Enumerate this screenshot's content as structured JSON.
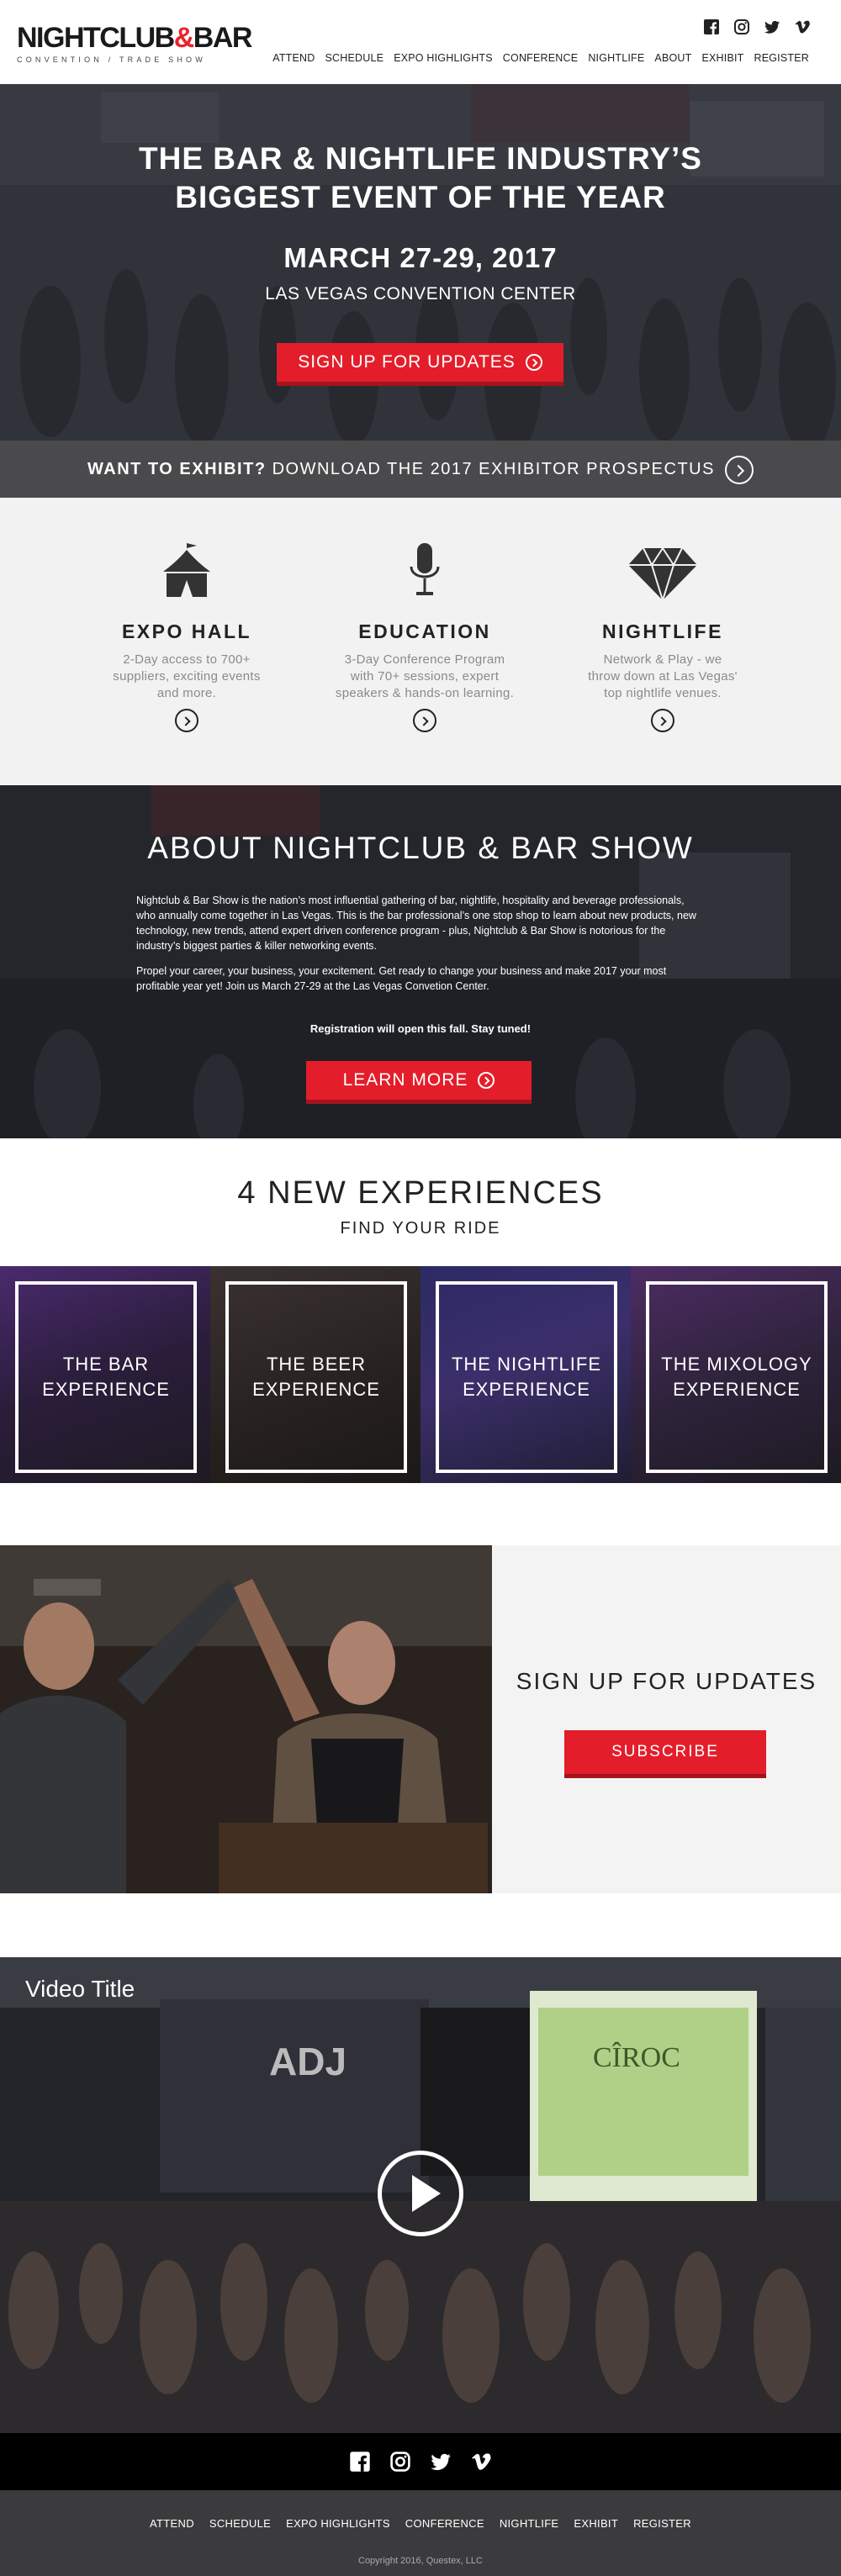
{
  "header": {
    "logo_main_a": "NIGHTCLUB",
    "logo_amp": "&",
    "logo_main_b": "BAR",
    "logo_sub": "CONVENTION / TRADE SHOW",
    "social": [
      "facebook-icon",
      "instagram-icon",
      "twitter-icon",
      "vimeo-icon"
    ],
    "nav": [
      "ATTEND",
      "SCHEDULE",
      "EXPO HIGHLIGHTS",
      "CONFERENCE",
      "NIGHTLIFE",
      "ABOUT",
      "EXHIBIT",
      "REGISTER"
    ]
  },
  "hero": {
    "title_line1": "THE BAR & NIGHTLIFE INDUSTRY’S",
    "title_line2": "BIGGEST EVENT OF THE YEAR",
    "date": "MARCH 27-29, 2017",
    "venue": "LAS VEGAS CONVENTION CENTER",
    "cta": "SIGN UP FOR UPDATES"
  },
  "exhibit": {
    "bold": "WANT TO EXHIBIT?",
    "rest": "DOWNLOAD THE 2017 EXHIBITOR PROSPECTUS"
  },
  "features": [
    {
      "title": "EXPO HALL",
      "desc_1": "2-Day access to 700+",
      "desc_2": "suppliers, exciting events",
      "desc_3": "and more."
    },
    {
      "title": "EDUCATION",
      "desc_1": "3-Day Conference Program",
      "desc_2": "with 70+ sessions, expert",
      "desc_3": "speakers & hands-on learning."
    },
    {
      "title": "NIGHTLIFE",
      "desc_1": "Network & Play - we",
      "desc_2": "throw down at Las Vegas'",
      "desc_3": "top nightlife venues."
    }
  ],
  "about": {
    "title": "ABOUT NIGHTCLUB & BAR SHOW",
    "para1": "Nightclub & Bar Show is the nation’s most influential gathering of bar, nightlife, hospitality and beverage professionals, who annually come together in Las Vegas. This is the bar professional’s one stop shop to learn about new products, new technology, new trends, attend expert driven conference program - plus, Nightclub & Bar Show is notorious for the industry’s biggest parties & killer networking events.",
    "para2": "Propel your career, your business, your excitement. Get ready to change your business and make 2017 your most profitable year yet! Join us March 27-29 at the Las Vegas Convetion Center.",
    "note": "Registration will open this fall. Stay tuned!",
    "cta": "LEARN MORE"
  },
  "experiences": {
    "title": "4 NEW EXPERIENCES",
    "subtitle": "FIND YOUR RIDE",
    "tiles": [
      {
        "line1": "THE BAR",
        "line2": "EXPERIENCE"
      },
      {
        "line1": "THE BEER",
        "line2": "EXPERIENCE"
      },
      {
        "line1": "THE NIGHTLIFE",
        "line2": "EXPERIENCE"
      },
      {
        "line1": "THE MIXOLOGY",
        "line2": "EXPERIENCE"
      }
    ]
  },
  "signup": {
    "title": "SIGN UP FOR UPDATES",
    "button": "SUBSCRIBE"
  },
  "video": {
    "title": "Video Title"
  },
  "footer": {
    "links": [
      "ATTEND",
      "SCHEDULE",
      "EXPO HIGHLIGHTS",
      "CONFERENCE",
      "NIGHTLIFE",
      "EXHIBIT",
      "REGISTER"
    ],
    "copyright": "Copyright 2016, Questex, LLC"
  },
  "colors": {
    "accent": "#e31e2a",
    "dark_bar": "#4a4a4c",
    "footer": "#3b3b3d"
  }
}
